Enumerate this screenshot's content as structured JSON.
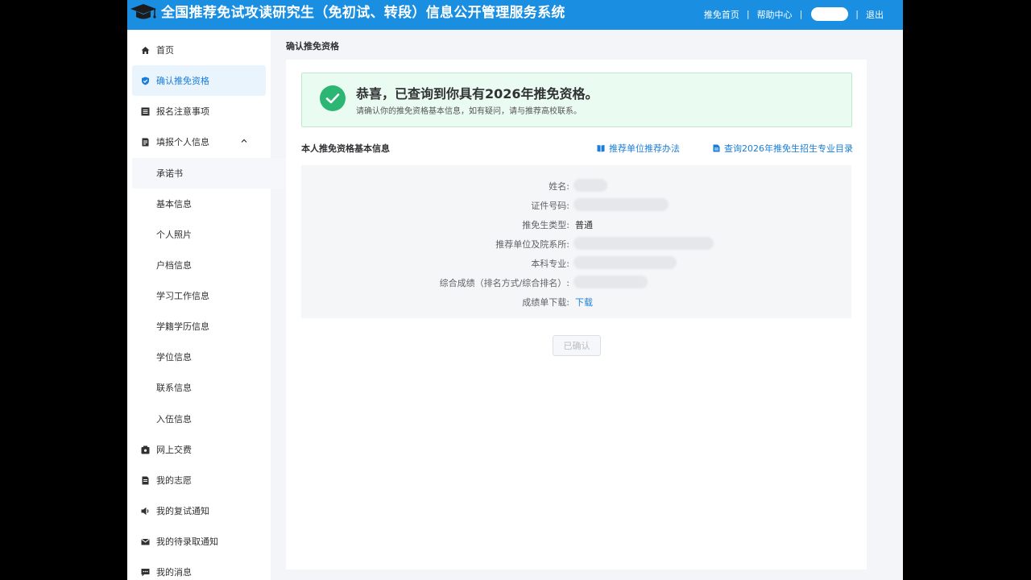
{
  "header": {
    "title": "全国推荐免试攻读研究生（免初试、转段）信息公开管理服务系统",
    "links": {
      "home": "推免首页",
      "help": "帮助中心",
      "logout": "退出"
    },
    "separator": "|"
  },
  "sidebar": {
    "items": [
      {
        "label": "首页",
        "icon": "home-icon"
      },
      {
        "label": "确认推免资格",
        "icon": "shield-icon",
        "active": true
      },
      {
        "label": "报名注意事项",
        "icon": "list-icon"
      },
      {
        "label": "填报个人信息",
        "icon": "form-icon",
        "expanded": true
      },
      {
        "label": "承诺书",
        "sub": true
      },
      {
        "label": "基本信息",
        "sub": true
      },
      {
        "label": "个人照片",
        "sub": true
      },
      {
        "label": "户档信息",
        "sub": true
      },
      {
        "label": "学习工作信息",
        "sub": true
      },
      {
        "label": "学籍学历信息",
        "sub": true
      },
      {
        "label": "学位信息",
        "sub": true
      },
      {
        "label": "联系信息",
        "sub": true
      },
      {
        "label": "入伍信息",
        "sub": true
      },
      {
        "label": "网上交费",
        "icon": "wallet-icon"
      },
      {
        "label": "我的志愿",
        "icon": "doc-icon"
      },
      {
        "label": "我的复试通知",
        "icon": "speaker-icon"
      },
      {
        "label": "我的待录取通知",
        "icon": "mail-icon"
      },
      {
        "label": "我的消息",
        "icon": "message-icon"
      }
    ]
  },
  "main": {
    "breadcrumb": "确认推免资格",
    "success": {
      "title": "恭喜，已查询到你具有2026年推免资格。",
      "subtitle": "请确认你的推免资格基本信息，如有疑问，请与推荐高校联系。"
    },
    "section_title": "本人推免资格基本信息",
    "links": {
      "method": "推荐单位推荐办法",
      "catalog": "查询2026年推免生招生专业目录"
    },
    "info": {
      "name_label": "姓名:",
      "id_label": "证件号码:",
      "type_label": "推免生类型:",
      "type_value": "普通",
      "unit_label": "推荐单位及院系所:",
      "major_label": "本科专业:",
      "score_label": "综合成绩（排名方式/综合排名）:",
      "download_label": "成绩单下载:",
      "download_value": "下载"
    },
    "confirm_button": "已确认"
  },
  "colors": {
    "brand": "#1a8ee0",
    "link": "#1a7ed8",
    "success": "#2bb673",
    "success_bg": "#eafbf2"
  }
}
